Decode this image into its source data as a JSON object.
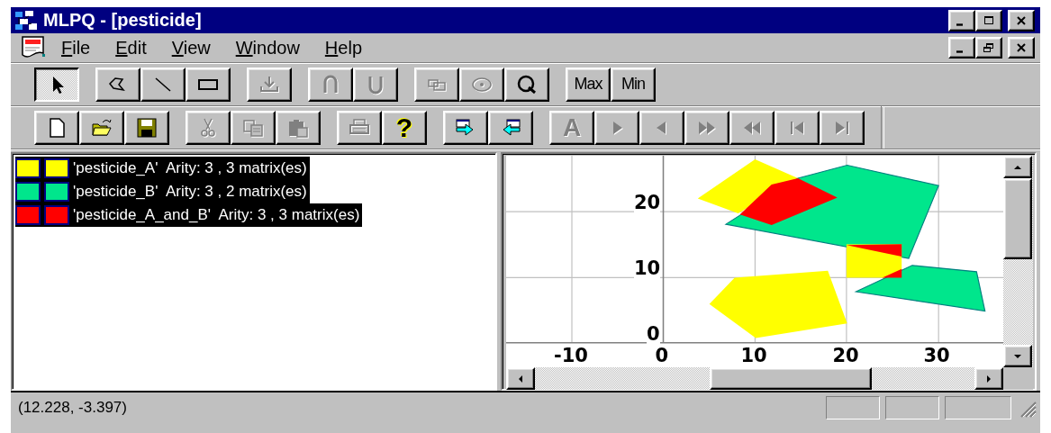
{
  "window": {
    "title": "MLPQ - [pesticide]"
  },
  "menu": [
    {
      "label": "File"
    },
    {
      "label": "Edit"
    },
    {
      "label": "View"
    },
    {
      "label": "Window"
    },
    {
      "label": "Help"
    }
  ],
  "toolbars": [
    [
      [
        {
          "kind": "pointer",
          "pressed": true,
          "disabled": false
        }
      ],
      [
        {
          "kind": "polygon",
          "pressed": false,
          "disabled": false
        },
        {
          "kind": "line",
          "pressed": false,
          "disabled": false
        },
        {
          "kind": "rectangle",
          "pressed": false,
          "disabled": false
        }
      ],
      [
        {
          "kind": "import",
          "pressed": false,
          "disabled": true
        }
      ],
      [
        {
          "kind": "intersect",
          "pressed": false,
          "disabled": true
        },
        {
          "kind": "union",
          "pressed": false,
          "disabled": true
        }
      ],
      [
        {
          "kind": "group",
          "pressed": false,
          "disabled": true
        },
        {
          "kind": "ellipse",
          "pressed": false,
          "disabled": true
        },
        {
          "kind": "zoom",
          "pressed": false,
          "disabled": false
        }
      ],
      [
        {
          "kind": "label",
          "label": "Max",
          "pressed": false,
          "disabled": false
        },
        {
          "kind": "label",
          "label": "Min",
          "pressed": false,
          "disabled": false
        }
      ]
    ],
    [
      [
        {
          "kind": "new",
          "pressed": false,
          "disabled": false
        },
        {
          "kind": "open",
          "pressed": false,
          "disabled": false
        },
        {
          "kind": "save",
          "pressed": false,
          "disabled": false
        }
      ],
      [
        {
          "kind": "cut",
          "pressed": false,
          "disabled": true
        },
        {
          "kind": "copy",
          "pressed": false,
          "disabled": true
        },
        {
          "kind": "paste",
          "pressed": false,
          "disabled": true
        }
      ],
      [
        {
          "kind": "print",
          "pressed": false,
          "disabled": true
        },
        {
          "kind": "help",
          "label": "?",
          "pressed": false,
          "disabled": false
        }
      ],
      [
        {
          "kind": "send",
          "pressed": false,
          "disabled": false
        },
        {
          "kind": "receive",
          "pressed": false,
          "disabled": false
        }
      ],
      [
        {
          "kind": "letter",
          "label": "A",
          "pressed": false,
          "disabled": true
        },
        {
          "kind": "play",
          "pressed": false,
          "disabled": true
        },
        {
          "kind": "step_back",
          "pressed": false,
          "disabled": true
        },
        {
          "kind": "fast_forward",
          "pressed": false,
          "disabled": true
        },
        {
          "kind": "rewind",
          "pressed": false,
          "disabled": true
        },
        {
          "kind": "first",
          "pressed": false,
          "disabled": true
        },
        {
          "kind": "last",
          "pressed": false,
          "disabled": true
        }
      ]
    ]
  ],
  "layers": [
    {
      "text": "'pesticide_A'  Arity: 3 , 3 matrix(es)",
      "color": "#ffff00",
      "selected": true
    },
    {
      "text": "'pesticide_B'  Arity: 3 , 2 matrix(es)",
      "color": "#00e68c",
      "selected": true
    },
    {
      "text": "'pesticide_A_and_B'  Arity: 3 , 3 matrix(es)",
      "color": "#ff0000",
      "selected": true
    }
  ],
  "plot": {
    "y_ticks": [
      "20",
      "10",
      "0"
    ],
    "x_ticks": [
      "-10",
      "0",
      "10",
      "20",
      "30"
    ]
  },
  "status_bar": {
    "text": "(12.228, -3.397)"
  }
}
